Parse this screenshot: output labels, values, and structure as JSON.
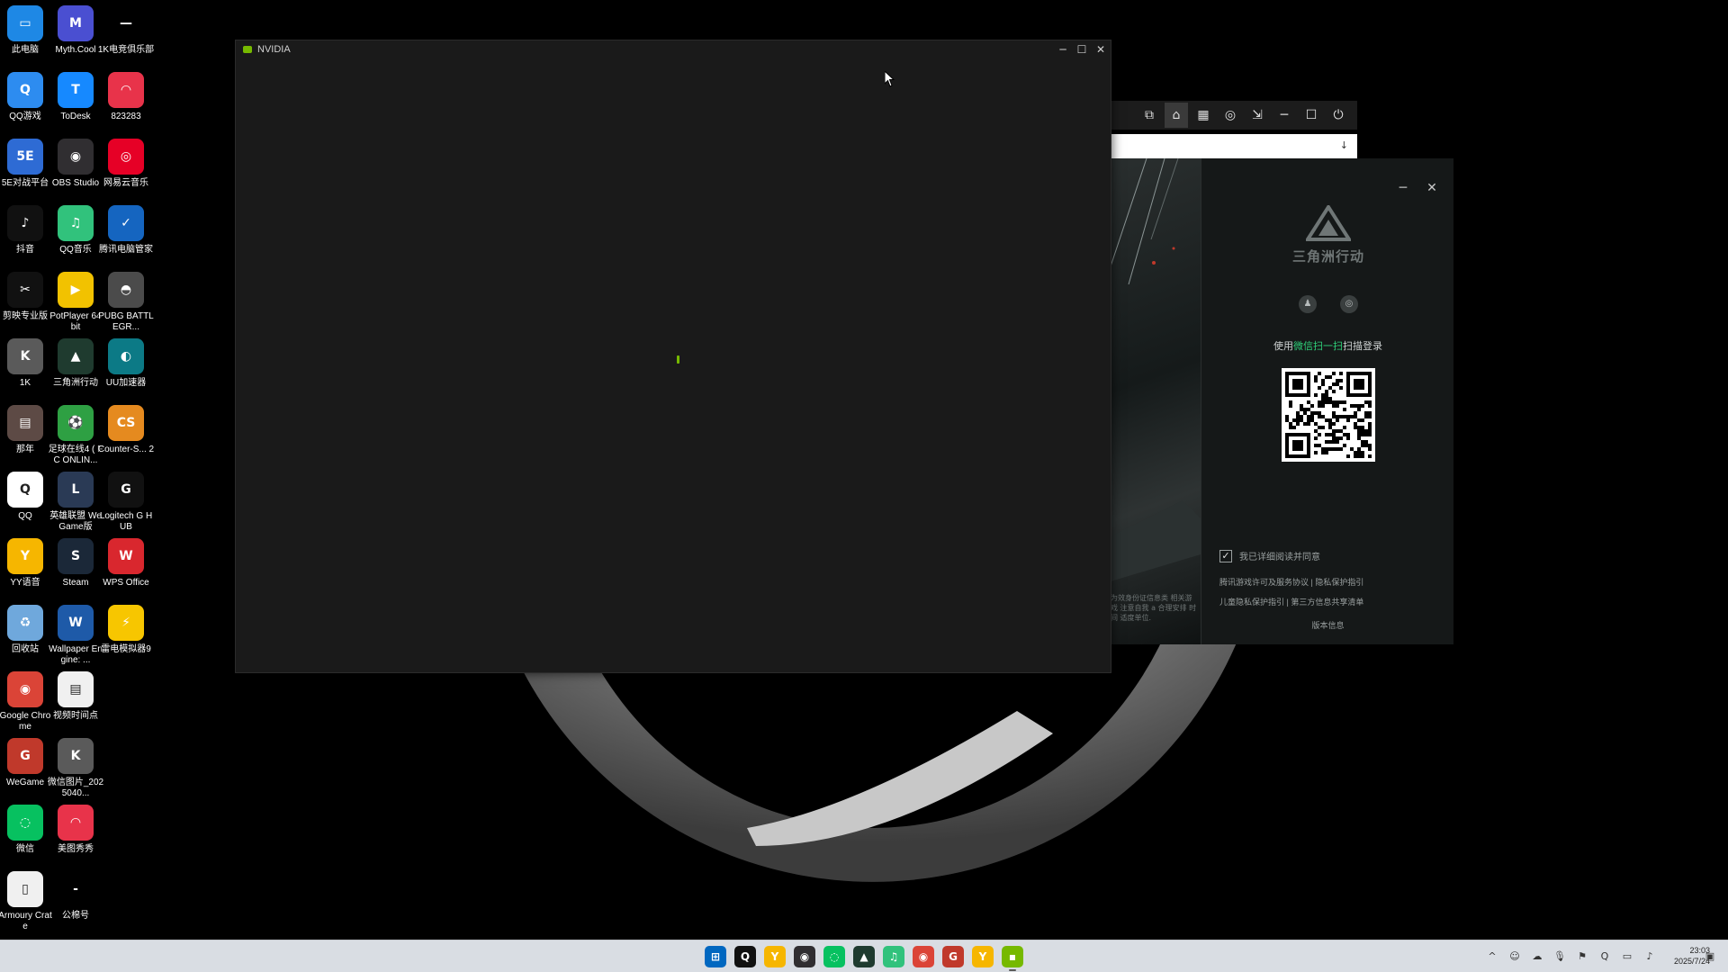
{
  "desktop_icons": [
    {
      "label": "此电脑",
      "glyph": "▭",
      "color": "#1e88e5",
      "icon": "computer-icon"
    },
    {
      "label": "Myth.Cool",
      "glyph": "M",
      "color": "#4a4fd1",
      "icon": "myth-cool-icon"
    },
    {
      "label": "1K电竞俱乐部",
      "glyph": "—",
      "color": "#000000",
      "icon": "1k-club-icon"
    },
    {
      "label": "QQ游戏",
      "glyph": "Q",
      "color": "#2d8cf0",
      "icon": "qq-game-icon"
    },
    {
      "label": "ToDesk",
      "glyph": "T",
      "color": "#1689ff",
      "icon": "todesk-icon"
    },
    {
      "label": "823283",
      "glyph": "◠",
      "color": "#e8334a",
      "icon": "823283-icon"
    },
    {
      "label": "5E对战平台",
      "glyph": "5E",
      "color": "#2e6bd4",
      "icon": "5e-platform-icon"
    },
    {
      "label": "OBS Studio",
      "glyph": "◉",
      "color": "#302e31",
      "icon": "obs-icon"
    },
    {
      "label": "网易云音乐",
      "glyph": "◎",
      "color": "#e60026",
      "icon": "netease-music-icon"
    },
    {
      "label": "抖音",
      "glyph": "♪",
      "color": "#111111",
      "icon": "douyin-icon"
    },
    {
      "label": "QQ音乐",
      "glyph": "♫",
      "color": "#31c27c",
      "icon": "qq-music-icon"
    },
    {
      "label": "腾讯电脑管家",
      "glyph": "✓",
      "color": "#1565c0",
      "icon": "tencent-manager-icon"
    },
    {
      "label": "剪映专业版",
      "glyph": "✂",
      "color": "#111111",
      "icon": "capcut-icon"
    },
    {
      "label": "PotPlayer 64 bit",
      "glyph": "▶",
      "color": "#f2c200",
      "icon": "potplayer-icon"
    },
    {
      "label": "PUBG BATTLEGR...",
      "glyph": "◓",
      "color": "#4b4b4b",
      "icon": "pubg-icon"
    },
    {
      "label": "1K",
      "glyph": "K",
      "color": "#5a5a5a",
      "icon": "1k-icon"
    },
    {
      "label": "三角洲行动",
      "glyph": "▲",
      "color": "#1f3b2f",
      "icon": "delta-force-icon"
    },
    {
      "label": "UU加速器",
      "glyph": "◐",
      "color": "#0c7a86",
      "icon": "uu-booster-icon"
    },
    {
      "label": "那年",
      "glyph": "▤",
      "color": "#5d4a45",
      "icon": "photo-icon"
    },
    {
      "label": "足球在线4 ( FC ONLIN...",
      "glyph": "⚽",
      "color": "#2ea043",
      "icon": "fc-online-icon"
    },
    {
      "label": "Counter-S... 2",
      "glyph": "CS",
      "color": "#e58a1f",
      "icon": "cs2-icon"
    },
    {
      "label": "QQ",
      "glyph": "Q",
      "color": "#ffffff",
      "icon": "qq-icon"
    },
    {
      "label": "英雄联盟 WeGame版",
      "glyph": "L",
      "color": "#2a3a55",
      "icon": "lol-icon"
    },
    {
      "label": "Logitech G HUB",
      "glyph": "G",
      "color": "#111111",
      "icon": "logitech-icon"
    },
    {
      "label": "YY语音",
      "glyph": "Y",
      "color": "#f6b600",
      "icon": "yy-icon"
    },
    {
      "label": "Steam",
      "glyph": "S",
      "color": "#1b2838",
      "icon": "steam-icon"
    },
    {
      "label": "WPS Office",
      "glyph": "W",
      "color": "#d9272e",
      "icon": "wps-icon"
    },
    {
      "label": "回收站",
      "glyph": "♻",
      "color": "#6fa8dc",
      "icon": "recycle-bin-icon"
    },
    {
      "label": "Wallpaper Engine: ...",
      "glyph": "W",
      "color": "#1e5aa8",
      "icon": "wallpaper-engine-icon"
    },
    {
      "label": "雷电模拟器9",
      "glyph": "⚡",
      "color": "#f7c600",
      "icon": "ldplayer-icon"
    },
    {
      "label": "Google Chrome",
      "glyph": "◉",
      "color": "#db4437",
      "icon": "chrome-icon"
    },
    {
      "label": "视频时间点",
      "glyph": "▤",
      "color": "#f0f0f0",
      "icon": "text-file-icon"
    },
    {
      "label": "",
      "glyph": "",
      "color": "#000000",
      "icon": "empty-slot"
    },
    {
      "label": "WeGame",
      "glyph": "G",
      "color": "#c0392b",
      "icon": "wegame-icon"
    },
    {
      "label": "微信图片_2025040...",
      "glyph": "K",
      "color": "#5a5a5a",
      "icon": "wechat-image-icon"
    },
    {
      "label": "",
      "glyph": "",
      "color": "#000000",
      "icon": "empty-slot"
    },
    {
      "label": "微信",
      "glyph": "◌",
      "color": "#07c160",
      "icon": "wechat-icon"
    },
    {
      "label": "美图秀秀",
      "glyph": "◠",
      "color": "#e8334a",
      "icon": "meitu-icon"
    },
    {
      "label": "",
      "glyph": "",
      "color": "#000000",
      "icon": "empty-slot"
    },
    {
      "label": "Armoury Crate",
      "glyph": "▯",
      "color": "#f0f0f0",
      "icon": "armoury-crate-icon"
    },
    {
      "label": "公棉号",
      "glyph": "-",
      "color": "#000000",
      "icon": "shortcut-icon"
    }
  ],
  "nvidia_window": {
    "title": "NVIDIA",
    "controls": {
      "minimize": "─",
      "maximize": "☐",
      "close": "✕"
    }
  },
  "launcher_toolbar": {
    "buttons": [
      {
        "glyph": "⧉",
        "name": "record-icon"
      },
      {
        "glyph": "⌂",
        "name": "home-icon",
        "active": true
      },
      {
        "glyph": "▦",
        "name": "library-icon"
      },
      {
        "glyph": "◎",
        "name": "gamepad-icon"
      },
      {
        "glyph": "⇲",
        "name": "download-icon"
      },
      {
        "glyph": "─",
        "name": "minimize-icon"
      },
      {
        "glyph": "☐",
        "name": "maximize-icon"
      },
      {
        "glyph": "⏻",
        "name": "power-icon"
      }
    ],
    "input_icon": "↓"
  },
  "login_window": {
    "game_title": "三角洲行动",
    "controls": {
      "minimize": "─",
      "close": "✕"
    },
    "login_options": [
      {
        "glyph": "♟",
        "name": "qq-login-icon"
      },
      {
        "glyph": "◎",
        "name": "wechat-login-icon"
      }
    ],
    "scan_hint_prefix": "使用",
    "scan_hint_highlight": "微信扫一扫",
    "scan_hint_suffix": "扫描登录",
    "agree_check": "✓",
    "agree_text": "我已详细阅读并同意",
    "policy_line_1": "腾讯游戏许可及服务协议 | 隐私保护指引",
    "policy_line_2": "儿童隐私保护指引 | 第三方信息共享清单",
    "version_link": "版本信息",
    "art_text": "为效身份证信息类 相关游戏 注意自我 a 合理安排 时间 适度单位."
  },
  "taskbar": {
    "apps": [
      {
        "glyph": "⊞",
        "color": "#0067c0",
        "name": "start-icon"
      },
      {
        "glyph": "Q",
        "color": "#111111",
        "name": "qq-icon"
      },
      {
        "glyph": "Y",
        "color": "#f6b600",
        "name": "yy-icon"
      },
      {
        "glyph": "◉",
        "color": "#302e31",
        "name": "obs-icon"
      },
      {
        "glyph": "◌",
        "color": "#07c160",
        "name": "wechat-icon"
      },
      {
        "glyph": "▲",
        "color": "#1f3b2f",
        "name": "delta-force-icon"
      },
      {
        "glyph": "♫",
        "color": "#31c27c",
        "name": "qq-music-icon"
      },
      {
        "glyph": "◉",
        "color": "#db4437",
        "name": "chrome-icon"
      },
      {
        "glyph": "G",
        "color": "#c0392b",
        "name": "wegame-icon"
      },
      {
        "glyph": "Y",
        "color": "#f6b600",
        "name": "yy-icon-2"
      },
      {
        "glyph": "▪",
        "color": "#76b900",
        "name": "nvidia-icon",
        "active": true
      }
    ],
    "tray": [
      {
        "glyph": "^",
        "name": "tray-expand-icon"
      },
      {
        "glyph": "☺",
        "name": "tray-app-icon"
      },
      {
        "glyph": "☁",
        "name": "onedrive-icon"
      },
      {
        "glyph": "🎙",
        "name": "mic-icon"
      },
      {
        "glyph": "⚑",
        "name": "tray-flag-icon"
      },
      {
        "glyph": "Q",
        "name": "qq-tray-icon"
      },
      {
        "glyph": "▭",
        "name": "network-icon"
      },
      {
        "glyph": "♪",
        "name": "volume-icon"
      }
    ],
    "time": "23:03",
    "date": "2025/7/24",
    "notification_glyph": "▣"
  }
}
